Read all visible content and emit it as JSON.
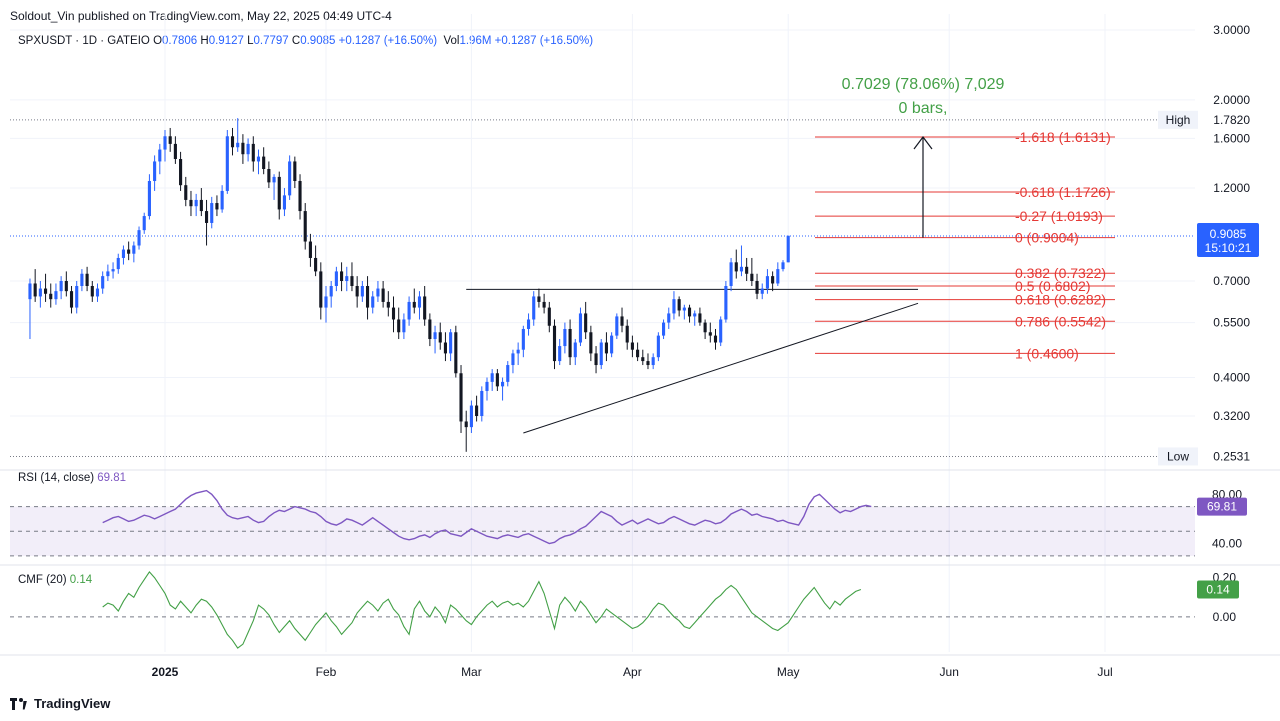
{
  "header": {
    "publisher": "Soldout_Vin published on TradingView.com, May 22, 2025 04:49 UTC-4",
    "symbol": "SPXUSDT · 1D · GATEIO",
    "o_label": "O",
    "o_value": "0.7806",
    "h_label": "H",
    "h_value": "0.9127",
    "l_label": "L",
    "l_value": "0.7797",
    "c_label": "C",
    "c_value": "0.9085",
    "change": "+0.1287 (+16.50%)",
    "vol_label": "Vol",
    "vol_value": "1.96M",
    "vol_change": "+0.1287 (+16.50%)"
  },
  "footer": {
    "brand": "TradingView"
  },
  "colors": {
    "up": "#2962ff",
    "down": "#131722",
    "fib": "#e53935",
    "measure": "#43a047",
    "rsi": "#7e57c2",
    "cmf": "#43a047"
  },
  "chart_data": [
    {
      "type": "candlestick",
      "scale": "log",
      "ylim": [
        0.245,
        3.0
      ],
      "y_ticks": [
        "3.0000",
        "2.0000",
        "1.6000",
        "1.2000",
        "0.7000",
        "0.5500",
        "0.4000",
        "0.3200"
      ],
      "y_tick_values": [
        3.0,
        2.0,
        1.6,
        1.2,
        0.7,
        0.55,
        0.4,
        0.32
      ],
      "x_ticks": [
        "2025",
        "Feb",
        "Mar",
        "Apr",
        "May",
        "Jun",
        "Jul"
      ],
      "x_tick_dates": [
        "2025-01-01",
        "2025-02-01",
        "2025-03-01",
        "2025-04-01",
        "2025-05-01",
        "2025-06-01",
        "2025-07-01"
      ],
      "start_date": "2024-12-06",
      "candles": [
        [
          0.63,
          0.71,
          0.5,
          0.69
        ],
        [
          0.69,
          0.75,
          0.62,
          0.64
        ],
        [
          0.64,
          0.7,
          0.6,
          0.67
        ],
        [
          0.67,
          0.73,
          0.62,
          0.65
        ],
        [
          0.65,
          0.69,
          0.6,
          0.63
        ],
        [
          0.63,
          0.69,
          0.61,
          0.66
        ],
        [
          0.66,
          0.72,
          0.63,
          0.7
        ],
        [
          0.7,
          0.74,
          0.64,
          0.66
        ],
        [
          0.66,
          0.68,
          0.58,
          0.6
        ],
        [
          0.6,
          0.7,
          0.58,
          0.68
        ],
        [
          0.68,
          0.75,
          0.66,
          0.73
        ],
        [
          0.73,
          0.76,
          0.66,
          0.68
        ],
        [
          0.68,
          0.7,
          0.62,
          0.64
        ],
        [
          0.64,
          0.69,
          0.62,
          0.67
        ],
        [
          0.67,
          0.74,
          0.65,
          0.72
        ],
        [
          0.72,
          0.77,
          0.7,
          0.74
        ],
        [
          0.74,
          0.78,
          0.71,
          0.75
        ],
        [
          0.75,
          0.82,
          0.73,
          0.8
        ],
        [
          0.8,
          0.86,
          0.77,
          0.84
        ],
        [
          0.84,
          0.88,
          0.79,
          0.82
        ],
        [
          0.82,
          0.88,
          0.78,
          0.86
        ],
        [
          0.86,
          0.96,
          0.84,
          0.94
        ],
        [
          0.94,
          1.04,
          0.92,
          1.02
        ],
        [
          1.02,
          1.3,
          1.0,
          1.25
        ],
        [
          1.25,
          1.45,
          1.18,
          1.4
        ],
        [
          1.4,
          1.55,
          1.3,
          1.5
        ],
        [
          1.5,
          1.68,
          1.4,
          1.62
        ],
        [
          1.62,
          1.7,
          1.48,
          1.55
        ],
        [
          1.55,
          1.62,
          1.38,
          1.42
        ],
        [
          1.42,
          1.48,
          1.18,
          1.22
        ],
        [
          1.22,
          1.28,
          1.08,
          1.12
        ],
        [
          1.12,
          1.18,
          1.02,
          1.08
        ],
        [
          1.08,
          1.16,
          1.02,
          1.12
        ],
        [
          1.12,
          1.2,
          1.02,
          1.05
        ],
        [
          1.05,
          1.12,
          0.86,
          0.98
        ],
        [
          0.98,
          1.14,
          0.95,
          1.1
        ],
        [
          1.1,
          1.15,
          1.02,
          1.06
        ],
        [
          1.06,
          1.22,
          1.04,
          1.18
        ],
        [
          1.18,
          1.68,
          1.16,
          1.62
        ],
        [
          1.62,
          1.7,
          1.45,
          1.52
        ],
        [
          1.52,
          1.8,
          1.48,
          1.56
        ],
        [
          1.56,
          1.64,
          1.38,
          1.46
        ],
        [
          1.46,
          1.6,
          1.4,
          1.55
        ],
        [
          1.55,
          1.62,
          1.32,
          1.4
        ],
        [
          1.4,
          1.5,
          1.3,
          1.44
        ],
        [
          1.44,
          1.52,
          1.3,
          1.34
        ],
        [
          1.34,
          1.4,
          1.2,
          1.24
        ],
        [
          1.24,
          1.3,
          1.12,
          1.28
        ],
        [
          1.28,
          1.32,
          1.0,
          1.06
        ],
        [
          1.06,
          1.2,
          1.02,
          1.15
        ],
        [
          1.15,
          1.45,
          1.12,
          1.4
        ],
        [
          1.4,
          1.44,
          1.2,
          1.25
        ],
        [
          1.25,
          1.3,
          1.0,
          1.05
        ],
        [
          1.05,
          1.1,
          0.84,
          0.88
        ],
        [
          0.88,
          0.92,
          0.76,
          0.8
        ],
        [
          0.8,
          0.86,
          0.72,
          0.74
        ],
        [
          0.74,
          0.78,
          0.56,
          0.6
        ],
        [
          0.6,
          0.68,
          0.55,
          0.64
        ],
        [
          0.64,
          0.7,
          0.6,
          0.68
        ],
        [
          0.68,
          0.76,
          0.66,
          0.74
        ],
        [
          0.74,
          0.78,
          0.66,
          0.7
        ],
        [
          0.7,
          0.76,
          0.66,
          0.72
        ],
        [
          0.72,
          0.78,
          0.66,
          0.68
        ],
        [
          0.68,
          0.72,
          0.6,
          0.64
        ],
        [
          0.64,
          0.7,
          0.62,
          0.68
        ],
        [
          0.68,
          0.72,
          0.56,
          0.6
        ],
        [
          0.6,
          0.66,
          0.58,
          0.64
        ],
        [
          0.64,
          0.7,
          0.62,
          0.67
        ],
        [
          0.67,
          0.7,
          0.6,
          0.62
        ],
        [
          0.62,
          0.66,
          0.57,
          0.6
        ],
        [
          0.6,
          0.64,
          0.52,
          0.56
        ],
        [
          0.56,
          0.6,
          0.5,
          0.52
        ],
        [
          0.52,
          0.58,
          0.5,
          0.56
        ],
        [
          0.56,
          0.64,
          0.54,
          0.62
        ],
        [
          0.62,
          0.67,
          0.58,
          0.6
        ],
        [
          0.6,
          0.66,
          0.56,
          0.64
        ],
        [
          0.64,
          0.68,
          0.54,
          0.56
        ],
        [
          0.56,
          0.58,
          0.48,
          0.5
        ],
        [
          0.5,
          0.54,
          0.46,
          0.52
        ],
        [
          0.52,
          0.55,
          0.47,
          0.49
        ],
        [
          0.49,
          0.52,
          0.44,
          0.46
        ],
        [
          0.46,
          0.53,
          0.44,
          0.52
        ],
        [
          0.52,
          0.54,
          0.4,
          0.41
        ],
        [
          0.41,
          0.43,
          0.29,
          0.31
        ],
        [
          0.31,
          0.33,
          0.26,
          0.3
        ],
        [
          0.3,
          0.35,
          0.29,
          0.34
        ],
        [
          0.34,
          0.36,
          0.31,
          0.32
        ],
        [
          0.32,
          0.38,
          0.31,
          0.37
        ],
        [
          0.37,
          0.4,
          0.35,
          0.39
        ],
        [
          0.39,
          0.42,
          0.37,
          0.41
        ],
        [
          0.41,
          0.42,
          0.37,
          0.38
        ],
        [
          0.38,
          0.4,
          0.35,
          0.39
        ],
        [
          0.39,
          0.44,
          0.38,
          0.43
        ],
        [
          0.43,
          0.47,
          0.41,
          0.46
        ],
        [
          0.46,
          0.49,
          0.43,
          0.47
        ],
        [
          0.47,
          0.54,
          0.45,
          0.53
        ],
        [
          0.53,
          0.58,
          0.51,
          0.56
        ],
        [
          0.56,
          0.66,
          0.54,
          0.64
        ],
        [
          0.64,
          0.67,
          0.6,
          0.62
        ],
        [
          0.62,
          0.65,
          0.58,
          0.6
        ],
        [
          0.6,
          0.62,
          0.52,
          0.54
        ],
        [
          0.54,
          0.56,
          0.42,
          0.44
        ],
        [
          0.44,
          0.5,
          0.43,
          0.48
        ],
        [
          0.48,
          0.55,
          0.46,
          0.53
        ],
        [
          0.53,
          0.56,
          0.43,
          0.45
        ],
        [
          0.45,
          0.5,
          0.43,
          0.49
        ],
        [
          0.49,
          0.6,
          0.48,
          0.58
        ],
        [
          0.58,
          0.62,
          0.5,
          0.52
        ],
        [
          0.52,
          0.54,
          0.44,
          0.46
        ],
        [
          0.46,
          0.48,
          0.41,
          0.43
        ],
        [
          0.43,
          0.5,
          0.42,
          0.49
        ],
        [
          0.49,
          0.52,
          0.44,
          0.46
        ],
        [
          0.46,
          0.52,
          0.45,
          0.51
        ],
        [
          0.51,
          0.58,
          0.5,
          0.57
        ],
        [
          0.57,
          0.6,
          0.52,
          0.54
        ],
        [
          0.54,
          0.56,
          0.47,
          0.49
        ],
        [
          0.49,
          0.51,
          0.45,
          0.47
        ],
        [
          0.47,
          0.49,
          0.44,
          0.45
        ],
        [
          0.45,
          0.47,
          0.43,
          0.44
        ],
        [
          0.44,
          0.46,
          0.42,
          0.43
        ],
        [
          0.43,
          0.46,
          0.42,
          0.45
        ],
        [
          0.45,
          0.52,
          0.44,
          0.51
        ],
        [
          0.51,
          0.56,
          0.5,
          0.55
        ],
        [
          0.55,
          0.6,
          0.53,
          0.58
        ],
        [
          0.58,
          0.66,
          0.56,
          0.63
        ],
        [
          0.63,
          0.64,
          0.57,
          0.59
        ],
        [
          0.59,
          0.61,
          0.56,
          0.6
        ],
        [
          0.6,
          0.61,
          0.55,
          0.57
        ],
        [
          0.57,
          0.59,
          0.54,
          0.58
        ],
        [
          0.58,
          0.6,
          0.54,
          0.55
        ],
        [
          0.55,
          0.56,
          0.5,
          0.52
        ],
        [
          0.52,
          0.55,
          0.49,
          0.51
        ],
        [
          0.51,
          0.53,
          0.47,
          0.49
        ],
        [
          0.49,
          0.57,
          0.48,
          0.56
        ],
        [
          0.56,
          0.7,
          0.55,
          0.68
        ],
        [
          0.68,
          0.8,
          0.66,
          0.78
        ],
        [
          0.78,
          0.84,
          0.71,
          0.74
        ],
        [
          0.74,
          0.86,
          0.72,
          0.76
        ],
        [
          0.76,
          0.8,
          0.7,
          0.73
        ],
        [
          0.73,
          0.8,
          0.68,
          0.7
        ],
        [
          0.7,
          0.73,
          0.63,
          0.65
        ],
        [
          0.65,
          0.69,
          0.63,
          0.67
        ],
        [
          0.67,
          0.75,
          0.65,
          0.72
        ],
        [
          0.72,
          0.74,
          0.66,
          0.69
        ],
        [
          0.69,
          0.78,
          0.68,
          0.75
        ],
        [
          0.75,
          0.79,
          0.74,
          0.78
        ],
        [
          0.78,
          0.91,
          0.78,
          0.91
        ]
      ],
      "volume_note": "",
      "trendline_resistance": {
        "price": 0.667,
        "from": "2025-02-28",
        "to": "2025-05-26"
      },
      "trendline_support": {
        "from_date": "2025-03-11",
        "from_price": 0.29,
        "to_date": "2025-05-26",
        "to_price": 0.615
      },
      "fib_levels": [
        {
          "label": "-1.618 (1.6131)",
          "price": 1.6131
        },
        {
          "label": "-0.618 (1.1726)",
          "price": 1.1726
        },
        {
          "label": "-0.27 (1.0193)",
          "price": 1.0193
        },
        {
          "label": "0 (0.9004)",
          "price": 0.9004
        },
        {
          "label": "0.382 (0.7322)",
          "price": 0.7322
        },
        {
          "label": "0.5 (0.6802)",
          "price": 0.6802
        },
        {
          "label": "0.618 (0.6282)",
          "price": 0.6282
        },
        {
          "label": "0.786 (0.5542)",
          "price": 0.5542
        },
        {
          "label": "1 (0.4600)",
          "price": 0.46
        }
      ],
      "measure": {
        "line1": "0.7029 (78.06%) 7,029",
        "line2": "0 bars,",
        "from_price": 0.9004,
        "to_price": 1.6131
      },
      "high": {
        "label": "High",
        "value": "1.7820",
        "price": 1.782
      },
      "low": {
        "label": "Low",
        "value": "0.2531",
        "price": 0.2531
      },
      "last_price": {
        "value": "0.9085",
        "countdown": "15:10:21",
        "price": 0.9085
      }
    },
    {
      "type": "line",
      "name": "RSI (14, close)",
      "label": "RSI (14, close)",
      "value_label": "69.81",
      "ylim": [
        25,
        90
      ],
      "band": [
        30,
        70
      ],
      "y_ticks": [
        "80.00",
        "40.00"
      ],
      "y_tick_values": [
        80,
        40
      ],
      "values": [
        57,
        59,
        61,
        62,
        60,
        58,
        59,
        61,
        63,
        62,
        60,
        62,
        64,
        66,
        68,
        72,
        76,
        79,
        81,
        82,
        83,
        80,
        75,
        68,
        63,
        61,
        60,
        61,
        62,
        59,
        57,
        58,
        62,
        65,
        67,
        66,
        68,
        70,
        69,
        68,
        66,
        65,
        62,
        58,
        56,
        55,
        57,
        60,
        59,
        57,
        55,
        58,
        61,
        58,
        55,
        52,
        49,
        46,
        44,
        43,
        44,
        46,
        47,
        45,
        48,
        50,
        51,
        48,
        47,
        46,
        49,
        52,
        50,
        48,
        46,
        45,
        44,
        46,
        47,
        46,
        45,
        47,
        48,
        46,
        44,
        42,
        40,
        41,
        44,
        46,
        47,
        49,
        52,
        54,
        58,
        62,
        66,
        64,
        62,
        58,
        55,
        57,
        59,
        56,
        58,
        60,
        58,
        56,
        57,
        60,
        62,
        60,
        58,
        56,
        55,
        57,
        59,
        58,
        56,
        57,
        60,
        64,
        66,
        68,
        66,
        63,
        64,
        62,
        61,
        60,
        58,
        59,
        57,
        56,
        55,
        62,
        72,
        78,
        80,
        76,
        72,
        68,
        65,
        67,
        66,
        68,
        70,
        71,
        70
      ]
    },
    {
      "type": "line",
      "name": "CMF (20)",
      "label": "CMF (20)",
      "value_label": "0.14",
      "ylim": [
        -0.18,
        0.26
      ],
      "y_ticks": [
        "0.20",
        "0.00"
      ],
      "y_tick_values": [
        0.2,
        0.0
      ],
      "zero_line": 0,
      "values": [
        0.05,
        0.07,
        0.06,
        0.03,
        0.08,
        0.12,
        0.1,
        0.15,
        0.19,
        0.23,
        0.2,
        0.16,
        0.12,
        0.06,
        0.04,
        0.08,
        0.05,
        0.02,
        0.06,
        0.09,
        0.08,
        0.05,
        0.01,
        -0.04,
        -0.09,
        -0.12,
        -0.16,
        -0.14,
        -0.08,
        -0.02,
        0.06,
        0.04,
        0.01,
        -0.04,
        -0.08,
        -0.05,
        -0.02,
        -0.06,
        -0.09,
        -0.12,
        -0.08,
        -0.04,
        -0.01,
        0.02,
        -0.02,
        -0.05,
        -0.09,
        -0.06,
        -0.03,
        0.02,
        0.05,
        0.08,
        0.06,
        0.03,
        0.07,
        0.09,
        0.04,
        0.01,
        -0.05,
        -0.09,
        0.04,
        0.08,
        0.03,
        0.0,
        0.05,
        0.02,
        -0.03,
        0.06,
        0.04,
        0.01,
        -0.02,
        -0.04,
        0.0,
        0.03,
        0.06,
        0.08,
        0.05,
        0.07,
        0.08,
        0.06,
        0.07,
        0.05,
        0.08,
        0.13,
        0.18,
        0.12,
        0.03,
        -0.06,
        0.06,
        0.1,
        0.07,
        0.03,
        0.08,
        0.05,
        0.01,
        -0.03,
        0.0,
        0.04,
        0.02,
        0.0,
        -0.02,
        -0.04,
        -0.06,
        -0.05,
        -0.03,
        0.0,
        0.04,
        0.07,
        0.06,
        0.03,
        0.0,
        -0.02,
        -0.05,
        -0.06,
        -0.03,
        0.0,
        0.03,
        0.06,
        0.09,
        0.11,
        0.14,
        0.16,
        0.14,
        0.1,
        0.06,
        0.02,
        0.0,
        -0.02,
        -0.04,
        -0.06,
        -0.07,
        -0.05,
        -0.03,
        0.01,
        0.05,
        0.09,
        0.12,
        0.15,
        0.11,
        0.07,
        0.04,
        0.08,
        0.06,
        0.09,
        0.11,
        0.13,
        0.14
      ]
    }
  ]
}
